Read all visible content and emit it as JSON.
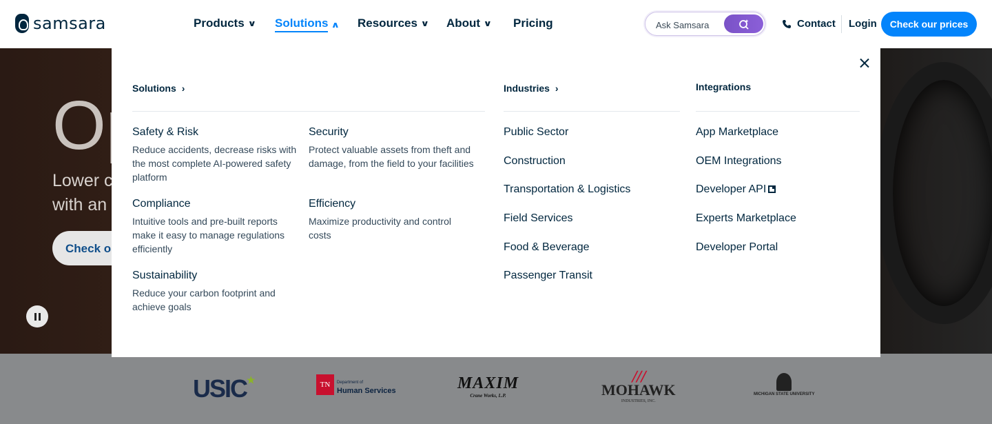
{
  "brand": {
    "name": "samsara"
  },
  "nav": {
    "items": [
      {
        "label": "Products",
        "chevron": "⌄"
      },
      {
        "label": "Solutions",
        "chevron": "⌃"
      },
      {
        "label": "Resources",
        "chevron": "⌄"
      },
      {
        "label": "About",
        "chevron": "⌄"
      },
      {
        "label": "Pricing"
      }
    ],
    "active": "Solutions"
  },
  "search": {
    "placeholder": "Ask Samsara"
  },
  "header_actions": {
    "contact": "Contact",
    "login": "Login",
    "cta": "Check our prices"
  },
  "hero": {
    "title": "Op",
    "subtitle_line1": "Lower c",
    "subtitle_line2": "with an c",
    "button": "Check ou"
  },
  "mega_menu": {
    "solutions": {
      "heading": "Solutions",
      "items": [
        {
          "title": "Safety & Risk",
          "desc": "Reduce accidents, decrease risks with the most complete AI-powered safety platform"
        },
        {
          "title": "Security",
          "desc": "Protect valuable assets from theft and damage, from the field to your facilities"
        },
        {
          "title": "Compliance",
          "desc": "Intuitive tools and pre-built reports make it easy to manage regulations efficiently"
        },
        {
          "title": "Efficiency",
          "desc": "Maximize productivity and control costs"
        },
        {
          "title": "Sustainability",
          "desc": "Reduce your carbon footprint and achieve goals"
        }
      ]
    },
    "industries": {
      "heading": "Industries",
      "items": [
        "Public Sector",
        "Construction",
        "Transportation & Logistics",
        "Field Services",
        "Food & Beverage",
        "Passenger Transit"
      ]
    },
    "integrations": {
      "heading": "Integrations",
      "items": [
        "App Marketplace",
        "OEM Integrations",
        "Developer API",
        "Experts Marketplace",
        "Developer Portal"
      ]
    }
  },
  "customers": {
    "usic": "USIC",
    "tn_box": "TN",
    "tn_text_1": "Department of",
    "tn_text_2": "Human Services",
    "maxim": "MAXIM",
    "maxim_sub": "Crane Works, L.P.",
    "mohawk": "MOHAWK",
    "mohawk_sub": "INDUSTRIES, INC.",
    "msu": "MICHIGAN STATE UNIVERSITY"
  },
  "colors": {
    "accent": "#0384fb",
    "navy": "#00263e",
    "search_purple": "#7a52c7"
  }
}
